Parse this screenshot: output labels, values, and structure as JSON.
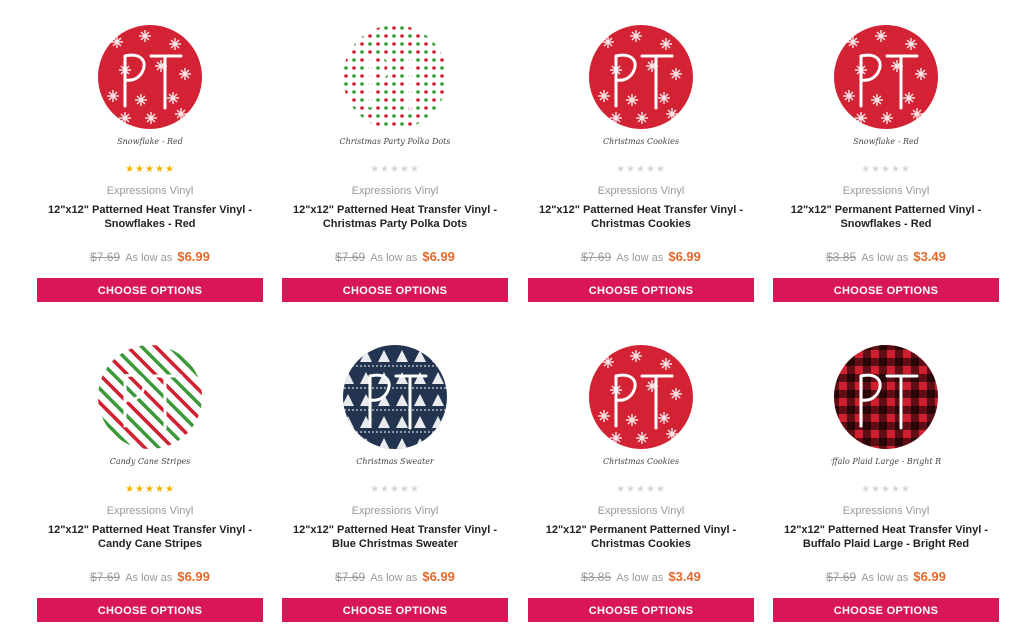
{
  "colors": {
    "accent": "#d9165a",
    "sale_price": "#e4692a",
    "star_filled": "#f4b400",
    "star_empty": "#d6d6d6"
  },
  "products": [
    {
      "caption": "Snowflake - Red",
      "rating": 5,
      "brand": "Expressions Vinyl",
      "title_line1": "12\"x12\" Patterned Heat Transfer Vinyl -",
      "title_line2": "Snowflakes - Red",
      "old_price": "$7.69",
      "as_low_as": "As low as",
      "price": "$6.99",
      "button": "CHOOSE OPTIONS",
      "pattern": "snowflake"
    },
    {
      "caption": "Christmas Party Polka Dots",
      "rating": 0,
      "brand": "Expressions Vinyl",
      "title_line1": "12\"x12\" Patterned Heat Transfer Vinyl -",
      "title_line2": "Christmas Party Polka Dots",
      "old_price": "$7.69",
      "as_low_as": "As low as",
      "price": "$6.99",
      "button": "CHOOSE OPTIONS",
      "pattern": "polka"
    },
    {
      "caption": "Christmas Cookies",
      "rating": 0,
      "brand": "Expressions Vinyl",
      "title_line1": "12\"x12\" Patterned Heat Transfer Vinyl -",
      "title_line2": "Christmas Cookies",
      "old_price": "$7.69",
      "as_low_as": "As low as",
      "price": "$6.99",
      "button": "CHOOSE OPTIONS",
      "pattern": "cookies"
    },
    {
      "caption": "Snowflake - Red",
      "rating": 0,
      "brand": "Expressions Vinyl",
      "title_line1": "12\"x12\" Permanent Patterned Vinyl -",
      "title_line2": "Snowflakes - Red",
      "old_price": "$3.85",
      "as_low_as": "As low as",
      "price": "$3.49",
      "button": "CHOOSE OPTIONS",
      "pattern": "snowflake"
    },
    {
      "caption": "Candy Cane Stripes",
      "rating": 5,
      "brand": "Expressions Vinyl",
      "title_line1": "12\"x12\" Patterned Heat Transfer Vinyl -",
      "title_line2": "Candy Cane Stripes",
      "old_price": "$7.69",
      "as_low_as": "As low as",
      "price": "$6.99",
      "button": "CHOOSE OPTIONS",
      "pattern": "stripes"
    },
    {
      "caption": "Christmas Sweater",
      "rating": 0,
      "brand": "Expressions Vinyl",
      "title_line1": "12\"x12\" Patterned Heat Transfer Vinyl -",
      "title_line2": "Blue Christmas Sweater",
      "old_price": "$7.69",
      "as_low_as": "As low as",
      "price": "$6.99",
      "button": "CHOOSE OPTIONS",
      "pattern": "sweater"
    },
    {
      "caption": "Christmas Cookies",
      "rating": 0,
      "brand": "Expressions Vinyl",
      "title_line1": "12\"x12\" Permanent Patterned Vinyl -",
      "title_line2": "Christmas Cookies",
      "old_price": "$3.85",
      "as_low_as": "As low as",
      "price": "$3.49",
      "button": "CHOOSE OPTIONS",
      "pattern": "cookies"
    },
    {
      "caption": "Buffalo Plaid Large - Bright Red",
      "rating": 0,
      "brand": "Expressions Vinyl",
      "title_line1": "12\"x12\" Patterned Heat Transfer Vinyl -",
      "title_line2": "Buffalo Plaid Large - Bright Red",
      "old_price": "$7.69",
      "as_low_as": "As low as",
      "price": "$6.99",
      "button": "CHOOSE OPTIONS",
      "pattern": "plaid"
    }
  ]
}
